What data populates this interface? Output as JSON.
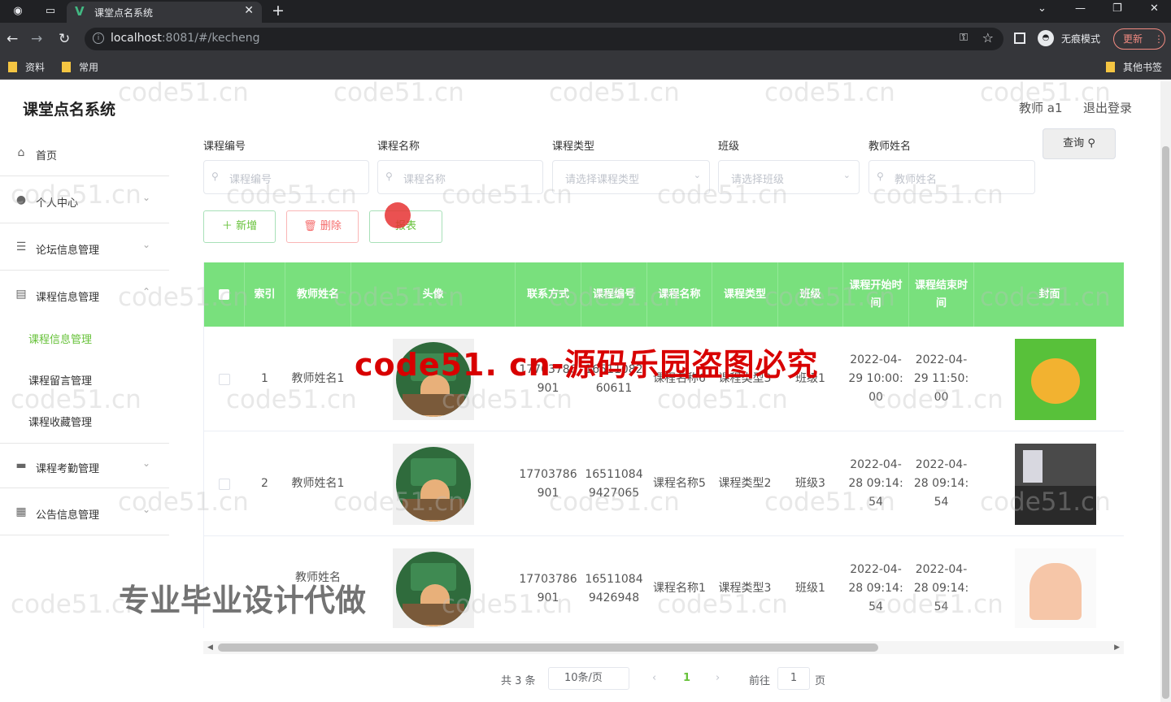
{
  "browser": {
    "tab_title": "课堂点名系统",
    "url_host": "localhost",
    "url_rest": ":8081/#/kecheng",
    "incognito_label": "无痕模式",
    "update_label": "更新",
    "bookmarks": [
      "资料",
      "常用"
    ],
    "other_bookmarks": "其他书签"
  },
  "app": {
    "title": "课堂点名系统",
    "user": "教师 a1",
    "logout": "退出登录"
  },
  "sidebar": {
    "items": [
      {
        "label": "首页",
        "icon": "home-icon"
      },
      {
        "label": "个人中心",
        "icon": "user-icon"
      },
      {
        "label": "论坛信息管理",
        "icon": "list-icon"
      },
      {
        "label": "课程信息管理",
        "icon": "doc-icon"
      },
      {
        "label": "课程考勤管理",
        "icon": "briefcase-icon"
      },
      {
        "label": "公告信息管理",
        "icon": "grid-icon"
      }
    ],
    "subitems": [
      "课程信息管理",
      "课程留言管理",
      "课程收藏管理"
    ]
  },
  "filters": {
    "course_no_label": "课程编号",
    "course_no_placeholder": "课程编号",
    "course_name_label": "课程名称",
    "course_name_placeholder": "课程名称",
    "course_type_label": "课程类型",
    "course_type_placeholder": "请选择课程类型",
    "class_label": "班级",
    "class_placeholder": "请选择班级",
    "teacher_label": "教师姓名",
    "teacher_placeholder": "教师姓名",
    "query_button": "查询"
  },
  "actions": {
    "add": "新增",
    "delete": "删除",
    "report": "报表"
  },
  "table": {
    "headers": [
      "索引",
      "教师姓名",
      "头像",
      "联系方式",
      "课程编号",
      "课程名称",
      "课程类型",
      "班级",
      "课程开始时间",
      "课程结束时间",
      "封面"
    ],
    "rows": [
      {
        "index": "1",
        "teacher": "教师姓名1",
        "contact": "17703786901",
        "course_no": "1651108260611",
        "course_name": "课程名称6",
        "course_type": "课程类型3",
        "class": "班级1",
        "start": "2022-04-29 10:00:00",
        "end": "2022-04-29 11:50:00"
      },
      {
        "index": "2",
        "teacher": "教师姓名1",
        "contact": "17703786901",
        "course_no": "165110849427065",
        "course_name": "课程名称5",
        "course_type": "课程类型2",
        "class": "班级3",
        "start": "2022-04-28 09:14:54",
        "end": "2022-04-28 09:14:54"
      },
      {
        "index": "",
        "teacher": "教师姓名",
        "contact": "17703786901",
        "course_no": "165110849426948",
        "course_name": "课程名称1",
        "course_type": "课程类型3",
        "class": "班级1",
        "start": "2022-04-28 09:14:54",
        "end": "2022-04-28 09:14:54"
      }
    ]
  },
  "pagination": {
    "total": "共 3 条",
    "page_size": "10条/页",
    "current": "1",
    "goto_label": "前往",
    "goto_value": "1",
    "page_suffix": "页"
  },
  "watermarks": {
    "site": "code51.cn",
    "banner": "code51. cn-源码乐园盗图必究",
    "promo": "专业毕业设计代做"
  },
  "colors": {
    "accent_green": "#67c23a",
    "header_green": "#79e07d",
    "danger_red": "#f56c6c"
  }
}
